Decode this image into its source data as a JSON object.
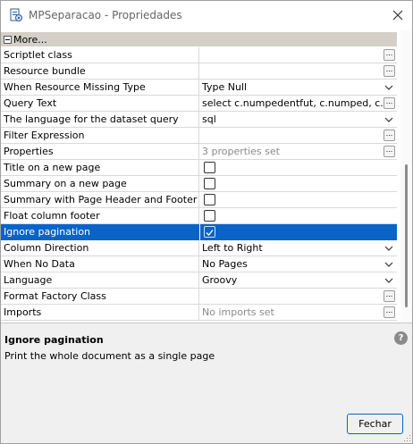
{
  "window": {
    "title": "MPSeparacao - Propriedades",
    "icons": {
      "app": "report-icon",
      "close": "close-icon"
    }
  },
  "section": {
    "label": "More..."
  },
  "properties": [
    {
      "name": "Scriptlet class",
      "value": "",
      "editor": "ellipsis"
    },
    {
      "name": "Resource bundle",
      "value": "",
      "editor": "ellipsis"
    },
    {
      "name": "When Resource Missing Type",
      "value": "Type Null",
      "editor": "combo"
    },
    {
      "name": "Query Text",
      "value": "select  c.numpedentfut,  c.numped,  c....",
      "editor": "ellipsis"
    },
    {
      "name": "The language for the dataset query",
      "value": "sql",
      "editor": "combo"
    },
    {
      "name": "Filter Expression",
      "value": "",
      "editor": "ellipsis"
    },
    {
      "name": "Properties",
      "value": "3 properties set",
      "editor": "ellipsis",
      "muted": true
    },
    {
      "name": "Title on a new page",
      "value": "",
      "editor": "checkbox",
      "checked": false
    },
    {
      "name": "Summary on a new page",
      "value": "",
      "editor": "checkbox",
      "checked": false
    },
    {
      "name": "Summary with Page Header and Footer",
      "value": "",
      "editor": "checkbox",
      "checked": false
    },
    {
      "name": "Float column footer",
      "value": "",
      "editor": "checkbox",
      "checked": false
    },
    {
      "name": "Ignore pagination",
      "value": "",
      "editor": "checkbox",
      "checked": true,
      "selected": true
    },
    {
      "name": "Column Direction",
      "value": "Left to Right",
      "editor": "combo"
    },
    {
      "name": "When No Data",
      "value": "No Pages",
      "editor": "combo"
    },
    {
      "name": "Language",
      "value": "Groovy",
      "editor": "combo"
    },
    {
      "name": "Format Factory Class",
      "value": "",
      "editor": "ellipsis"
    },
    {
      "name": "Imports",
      "value": "No imports set",
      "editor": "ellipsis",
      "muted": true
    }
  ],
  "ellipsis_label": "...",
  "description": {
    "title": "Ignore pagination",
    "text": "Print the whole document as a single page"
  },
  "help_glyph": "?",
  "buttons": {
    "close_label": "Fechar"
  },
  "colors": {
    "selection": "#0a64c8",
    "section_header": "#d4d0c8"
  }
}
